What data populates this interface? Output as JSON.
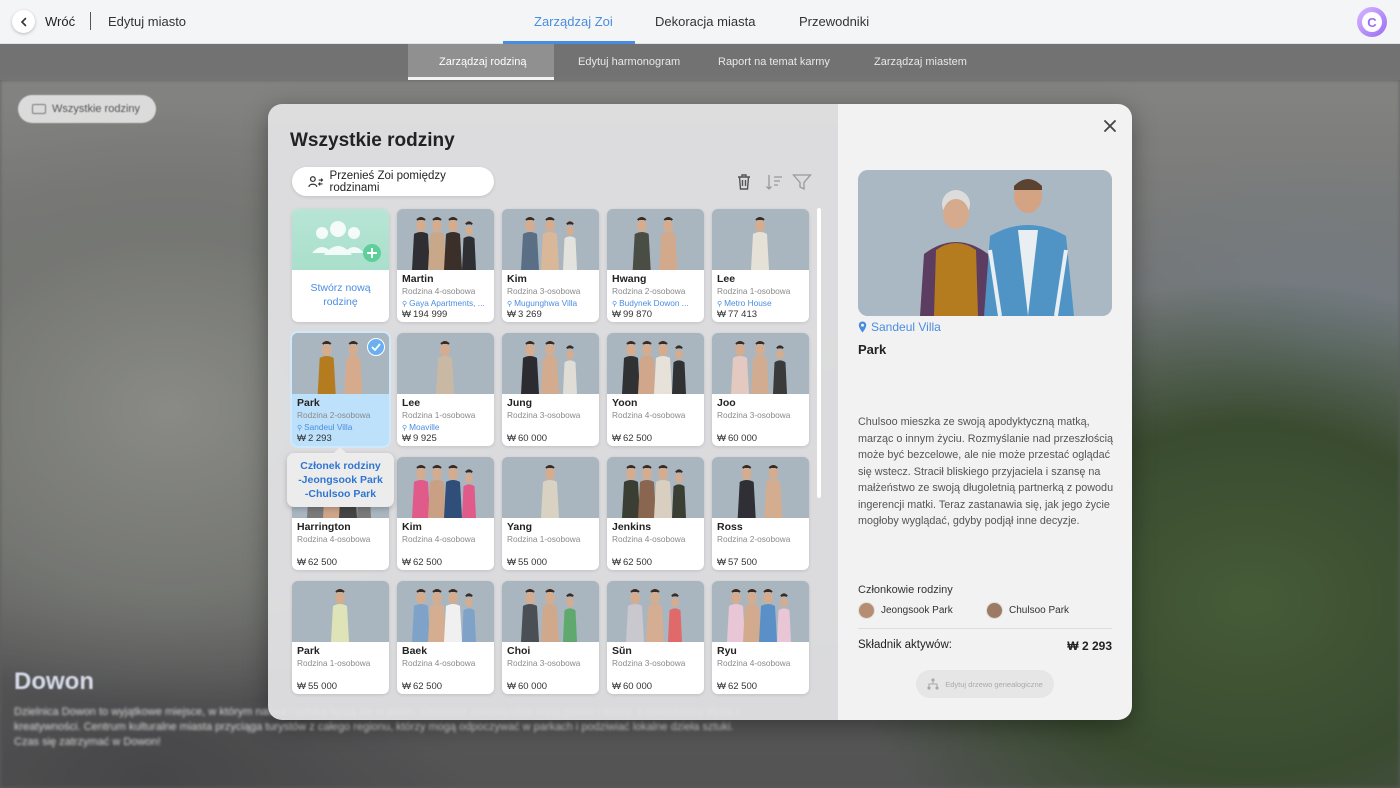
{
  "header": {
    "back_label": "Wróć",
    "edit_city_label": "Edytuj miasto",
    "tabs": [
      "Zarządzaj Zoi",
      "Dekoracja miasta",
      "Przewodniki"
    ],
    "active_tab": "Zarządzaj Zoi",
    "avatar_letter": "C"
  },
  "subtabs": [
    "Zarządzaj rodziną",
    "Edytuj harmonogram",
    "Raport na temat karmy",
    "Zarządzaj miastem"
  ],
  "background": {
    "chip_label": "Wszystkie rodziny",
    "city_name": "Dowon",
    "city_description": "Dzielnica Dowon to wyjątkowe miejsce, w którym natura i sztuka łączą się w jedno. Otoczone zielenią ulice kryją galerie i teatry, a mieszkańcy słyną z kreatywności. Centrum kulturalne miasta przyciąga turystów z całego regionu, którzy mogą odpoczywać w parkach i podziwiać lokalne dzieła sztuki. Czas się zatrzymać w Dowon!"
  },
  "modal": {
    "title": "Wszystkie rodziny",
    "transfer_button": "Przenieś Zoi pomiędzy rodzinami",
    "create_family_label": "Stwórz nową rodzinę",
    "currency_symbol": "₩",
    "families": [
      {
        "name": "Martin",
        "size": "Rodzina 4-osobowa",
        "location": "Gaya Apartments, ...",
        "value": "194 999"
      },
      {
        "name": "Kim",
        "size": "Rodzina 3-osobowa",
        "location": "Mugunghwa Villa",
        "value": "3 269"
      },
      {
        "name": "Hwang",
        "size": "Rodzina 2-osobowa",
        "location": "Budynek Dowon ...",
        "value": "99 870"
      },
      {
        "name": "Lee",
        "size": "Rodzina 1-osobowa",
        "location": "Metro House",
        "value": "77 413"
      },
      {
        "name": "Park",
        "size": "Rodzina 2-osobowa",
        "location": "Sandeul Villa",
        "value": "2 293"
      },
      {
        "name": "Lee",
        "size": "Rodzina 1-osobowa",
        "location": "Moaville",
        "value": "9 925"
      },
      {
        "name": "Jung",
        "size": "Rodzina 3-osobowa",
        "location": "",
        "value": "60 000"
      },
      {
        "name": "Yoon",
        "size": "Rodzina 4-osobowa",
        "location": "",
        "value": "62 500"
      },
      {
        "name": "Joo",
        "size": "Rodzina 3-osobowa",
        "location": "",
        "value": "60 000"
      },
      {
        "name": "Harrington",
        "size": "Rodzina 4-osobowa",
        "location": "",
        "value": "62 500"
      },
      {
        "name": "Kim",
        "size": "Rodzina 4-osobowa",
        "location": "",
        "value": "62 500"
      },
      {
        "name": "Yang",
        "size": "Rodzina 1-osobowa",
        "location": "",
        "value": "55 000"
      },
      {
        "name": "Jenkins",
        "size": "Rodzina 4-osobowa",
        "location": "",
        "value": "62 500"
      },
      {
        "name": "Ross",
        "size": "Rodzina 2-osobowa",
        "location": "",
        "value": "57 500"
      },
      {
        "name": "Park",
        "size": "Rodzina 1-osobowa",
        "location": "",
        "value": "55 000"
      },
      {
        "name": "Baek",
        "size": "Rodzina 4-osobowa",
        "location": "",
        "value": "62 500"
      },
      {
        "name": "Choi",
        "size": "Rodzina 3-osobowa",
        "location": "",
        "value": "60 000"
      },
      {
        "name": "Sŭn",
        "size": "Rodzina 3-osobowa",
        "location": "",
        "value": "60 000"
      },
      {
        "name": "Ryu",
        "size": "Rodzina 4-osobowa",
        "location": "",
        "value": "62 500"
      }
    ],
    "tooltip": {
      "line1": "Członek rodziny",
      "line2": "-Jeongsook Park",
      "line3": "-Chulsoo Park"
    }
  },
  "detail": {
    "location": "Sandeul Villa",
    "name": "Park",
    "description": "Chulsoo mieszka ze swoją apodyktyczną matką, marząc o innym życiu. Rozmyślanie nad przeszłością może być bezcelowe, ale nie może przestać oglądać się wstecz. Stracił bliskiego przyjaciela i szansę na małżeństwo ze swoją długoletnią partnerką z powodu ingerencji matki. Teraz zastanawia się, jak jego życie mogłoby wyglądać, gdyby podjął inne decyzje.",
    "members_title": "Członkowie rodziny",
    "members": [
      "Jeongsook Park",
      "Chulsoo Park"
    ],
    "assets_label": "Składnik aktywów:",
    "assets_value": "₩ 2 293",
    "tree_button": "Edytuj drzewo genealogiczne"
  },
  "colors": {
    "accent": "#4a8de0",
    "selected_card": "#bde0fb",
    "new_family_card": "#b8e5d5"
  }
}
